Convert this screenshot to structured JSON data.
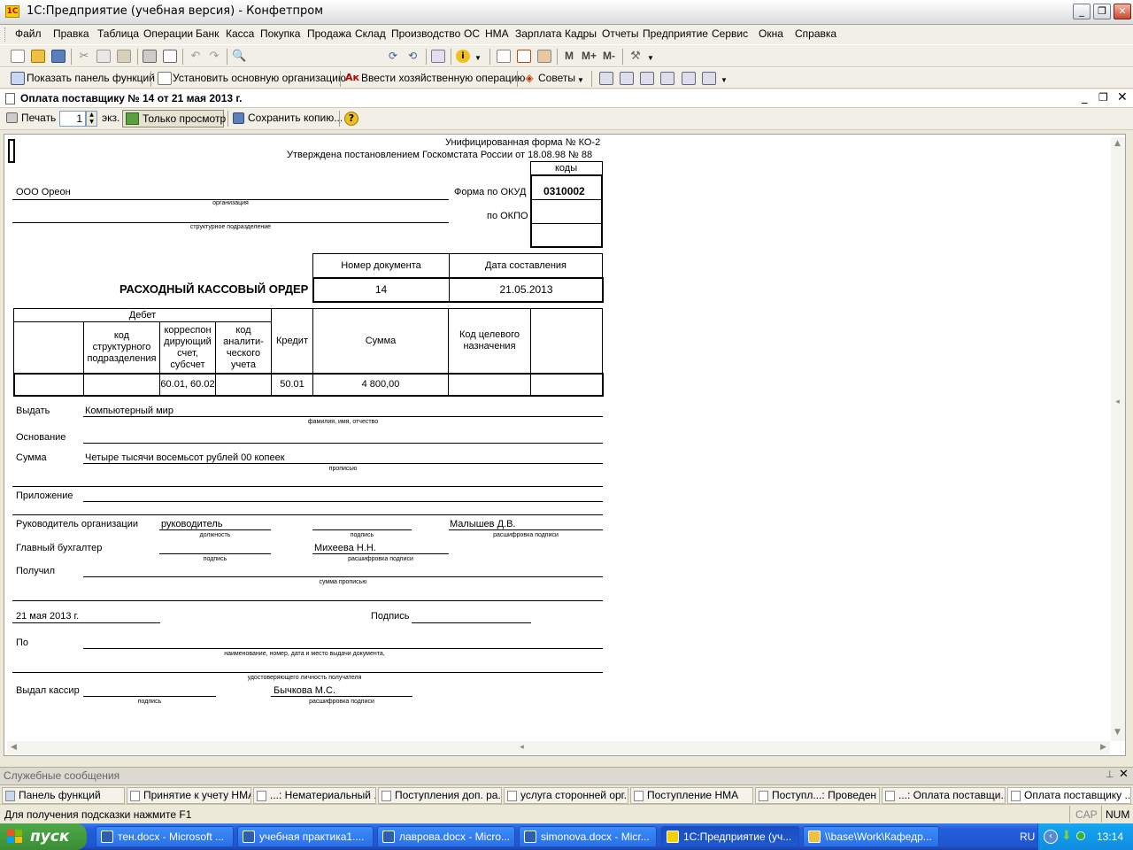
{
  "window": {
    "title": "1С:Предприятие (учебная версия) - Конфетпром"
  },
  "menu": [
    "Файл",
    "Правка",
    "Таблица",
    "Операции",
    "Банк",
    "Касса",
    "Покупка",
    "Продажа",
    "Склад",
    "Производство",
    "ОС",
    "НМА",
    "Зарплата",
    "Кадры",
    "Отчеты",
    "Предприятие",
    "Сервис",
    "Окна",
    "Справка"
  ],
  "toolbar2": {
    "show_panel": "Показать панель функций",
    "set_org": "Установить основную организацию",
    "enter_op": "Ввести хозяйственную операцию",
    "tips": "Советы"
  },
  "toolbar1": {
    "m": "M",
    "mplus": "M+",
    "mminus": "M-"
  },
  "doc_window": {
    "title": "Оплата поставщику № 14 от 21 мая 2013 г."
  },
  "doc_toolbar": {
    "print": "Печать",
    "copies": "1",
    "copies_unit": "экз.",
    "view_only": "Только просмотр",
    "save_copy": "Сохранить копию..."
  },
  "form": {
    "unified": "Унифицированная форма № КО-2",
    "approved": "Утверждена постановлением Госкомстата России от 18.08.98 № 88",
    "codes": "коды",
    "okud_label": "Форма по ОКУД",
    "okud": "0310002",
    "okpo_label": "по ОКПО",
    "org": "ООО Ореон",
    "org_caption": "организация",
    "subdiv_caption": "структурное подразделение",
    "doc_num_header": "Номер документа",
    "doc_date_header": "Дата составления",
    "title": "РАСХОДНЫЙ КАССОВЫЙ ОРДЕР",
    "doc_num": "14",
    "doc_date": "21.05.2013",
    "debit": "Дебет",
    "col_struct": "код\nструктурного\nподразделения",
    "col_corr": "корреспон\nдирующий\nсчет,\nсубсчет",
    "col_anal": "код\nаналити-\nческого\nучета",
    "col_credit": "Кредит",
    "col_sum": "Сумма",
    "col_target": "Код целевого\nназначения",
    "row_corr": "60.01, 60.02",
    "row_credit": "50.01",
    "row_sum": "4 800,00",
    "issue_label": "Выдать",
    "issue_value": "Компьютерный мир",
    "issue_caption": "фамилия, имя, отчество",
    "basis_label": "Основание",
    "sum_label": "Сумма",
    "sum_value": "Четыре тысячи восемьсот рублей 00 копеек",
    "sum_caption": "прописью",
    "attach_label": "Приложение",
    "head_label": "Руководитель организации",
    "head_position": "руководитель",
    "position_caption": "должность",
    "sign_caption": "подпись",
    "head_name": "Малышев Д.В.",
    "decode_caption": "расшифровка подписи",
    "chief_label": "Главный бухгалтер",
    "chief_name": "Михеева Н.Н.",
    "received_label": "Получил",
    "received_caption": "сумма прописью",
    "date_value": "21 мая 2013 г.",
    "signature_label": "Подпись",
    "by_label": "По",
    "by_caption": "наименование, номер, дата и место выдачи документа,",
    "id_caption": "удостоверяющего личность получателя",
    "cashier_label": "Выдал кассир",
    "cashier_name": "Бычкова М.С."
  },
  "service_messages": "Служебные сообщения",
  "window_tabs": [
    {
      "label": "Панель функций"
    },
    {
      "label": "Принятие к учету НМА"
    },
    {
      "label": "...: Нематериальный ..."
    },
    {
      "label": "Поступления доп. ра..."
    },
    {
      "label": "услуга сторонней орг..."
    },
    {
      "label": "Поступление НМА"
    },
    {
      "label": "Поступл...: Проведен *"
    },
    {
      "label": "...: Оплата поставщи..."
    },
    {
      "label": "Оплата поставщику ..."
    }
  ],
  "status": {
    "hint": "Для получения подсказки нажмите F1",
    "cap": "CAP",
    "num": "NUM"
  },
  "taskbar": {
    "start": "пуск",
    "tasks": [
      {
        "label": "тен.docx - Microsoft ..."
      },
      {
        "label": "учебная практика1...."
      },
      {
        "label": "лаврова.docx - Micro..."
      },
      {
        "label": "simonova.docx - Micr..."
      },
      {
        "label": "1С:Предприятие (уч..."
      },
      {
        "label": "\\\\base\\Work\\Кафедр..."
      }
    ],
    "lang": "RU",
    "time": "13:14"
  },
  "colors": {
    "taskbar": "#245edb",
    "start": "#3a8d35",
    "sheet": "#ffffff"
  }
}
